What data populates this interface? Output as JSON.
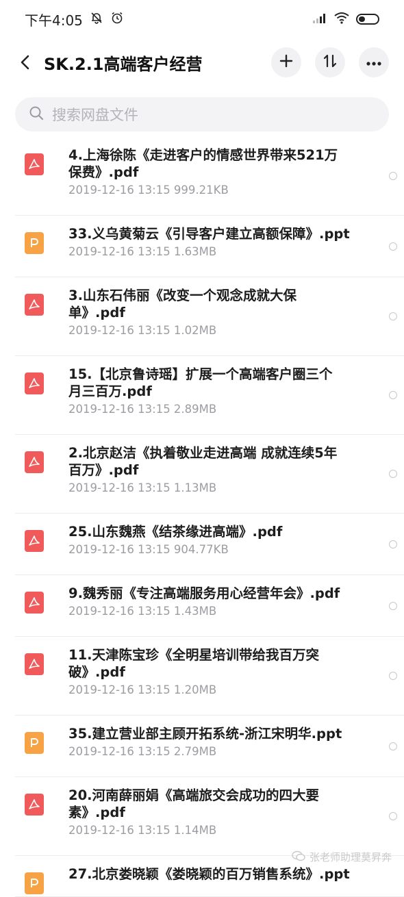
{
  "status": {
    "time": "下午4:05",
    "icons": [
      "mute-bell-icon",
      "alarm-icon",
      "signal-icon",
      "wifi-icon",
      "battery-icon"
    ]
  },
  "header": {
    "title": "SK.2.1高端客户经营",
    "back_icon": "back-arrow-icon",
    "actions": [
      "add-icon",
      "sort-icon",
      "more-icon"
    ]
  },
  "search": {
    "placeholder": "搜索网盘文件"
  },
  "files": [
    {
      "line1": "4.上海徐陈《走进客户的情感世界带来521万",
      "line2": "保费》.pdf",
      "meta": "2019-12-16  13:15  999.21KB",
      "type": "pdf"
    },
    {
      "line1": "33.义乌黄菊云《引导客户建立高额保障》.ppt",
      "line2": "",
      "meta": "2019-12-16  13:15  1.63MB",
      "type": "ppt"
    },
    {
      "line1": "3.山东石伟丽《改变一个观念成就大保",
      "line2": "单》.pdf",
      "meta": "2019-12-16  13:15  1.02MB",
      "type": "pdf"
    },
    {
      "line1": "15.【北京鲁诗瑶】扩展一个高端客户圈三个",
      "line2": "月三百万.pdf",
      "meta": "2019-12-16  13:15  2.89MB",
      "type": "pdf"
    },
    {
      "line1": "2.北京赵洁《执着敬业走进高端 成就连续5年",
      "line2": "百万》.pdf",
      "meta": "2019-12-16  13:15  1.13MB",
      "type": "pdf"
    },
    {
      "line1": "25.山东魏燕《结茶缘进高端》.pdf",
      "line2": "",
      "meta": "2019-12-16  13:15  904.77KB",
      "type": "pdf"
    },
    {
      "line1": "9.魏秀丽《专注高端服务用心经营年会》.pdf",
      "line2": "",
      "meta": "2019-12-16  13:15  1.43MB",
      "type": "pdf"
    },
    {
      "line1": "11.天津陈宝珍《全明星培训带给我百万突",
      "line2": "破》.pdf",
      "meta": "2019-12-16  13:15  1.20MB",
      "type": "pdf"
    },
    {
      "line1": "35.建立营业部主顾开拓系统-浙江宋明华.ppt",
      "line2": "",
      "meta": "2019-12-16  13:15  2.79MB",
      "type": "ppt"
    },
    {
      "line1": "20.河南薛丽娟《高端旅交会成功的四大要",
      "line2": "素》.pdf",
      "meta": "2019-12-16  13:15  1.14MB",
      "type": "pdf"
    },
    {
      "line1": "27.北京娄晓颖《娄晓颖的百万销售系统》.ppt",
      "line2": "",
      "meta": "",
      "type": "ppt"
    }
  ],
  "watermark": {
    "text": "张老师助理莫昇奔"
  },
  "colors": {
    "pdf": "#f05a5a",
    "ppt": "#f7a245"
  }
}
